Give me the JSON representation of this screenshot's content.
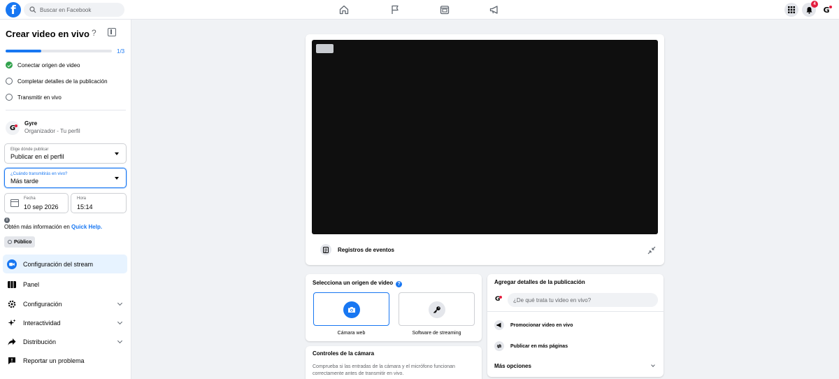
{
  "topbar": {
    "logo": "f",
    "search_placeholder": "Buscar en Facebook",
    "notifications_count": "4",
    "account_logo": "G"
  },
  "sidebar": {
    "title": "Crear video en vivo",
    "help": "?",
    "progress_label": "1/3",
    "progress_fraction": 0.333,
    "steps": [
      {
        "label": "Conectar origen de video",
        "done": true
      },
      {
        "label": "Completar detalles de la publicación",
        "done": false
      },
      {
        "label": "Transmitir en vivo",
        "done": false
      }
    ],
    "profile": {
      "avatar": "G",
      "name": "Gyre",
      "subtitle": "Organizador - Tu perfil"
    },
    "publish_where": {
      "label": "Elige dónde publicar",
      "value": "Publicar en el perfil"
    },
    "when": {
      "label": "¿Cuándo transmitirás en vivo?",
      "value": "Más tarde"
    },
    "date": {
      "label": "Fecha",
      "value": "10 sep 2026"
    },
    "time": {
      "label": "Hora",
      "value": "15:14"
    },
    "info_prefix": "Obtén más información en ",
    "info_link": "Quick Help.",
    "privacy": "Público",
    "menu": [
      {
        "label": "Configuración del stream",
        "icon": "video-camera-icon",
        "active": true
      },
      {
        "label": "Panel",
        "icon": "dashboard-icon"
      },
      {
        "label": "Configuración",
        "icon": "gear-icon",
        "expandable": true
      },
      {
        "label": "Interactividad",
        "icon": "sparkle-icon",
        "expandable": true
      },
      {
        "label": "Distribución",
        "icon": "share-icon",
        "expandable": true
      },
      {
        "label": "Reportar un problema",
        "icon": "report-icon"
      }
    ]
  },
  "preview": {
    "event_log": "Registros de eventos"
  },
  "source": {
    "title": "Selecciona un origen de video",
    "options": [
      {
        "label": "Cámara web",
        "selected": true
      },
      {
        "label": "Software de streaming",
        "selected": false
      }
    ]
  },
  "camera": {
    "title": "Controles de la cámara",
    "desc1": "Comprueba si las entradas de la cámara y el micrófono funcionan",
    "desc2": "correctamente antes de transmitir en vivo."
  },
  "post": {
    "title": "Agregar detalles de la publicación",
    "placeholder": "¿De qué trata tu video en vivo?",
    "promote": "Promocionar video en vivo",
    "publish_more": "Publicar en más páginas",
    "more_options": "Más opciones"
  },
  "colors": {
    "accent": "#1877f2",
    "success": "#31a24c",
    "badge": "#e41e3f"
  }
}
